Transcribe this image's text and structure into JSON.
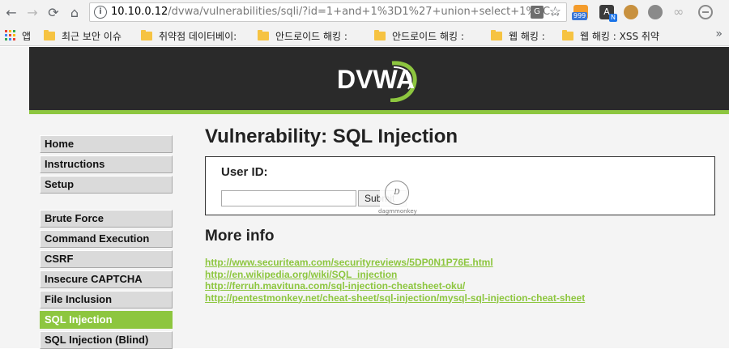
{
  "browser": {
    "back_glyph": "←",
    "forward_glyph": "→",
    "reload_glyph": "⟳",
    "home_glyph": "⌂",
    "url_host": "10.10.0.12",
    "url_rest": "/dvwa/vulnerabilities/sqli/?id=1+and+1%3D1%27+union+select+1%2C...",
    "info_glyph": "i",
    "translate_glyph": "G",
    "star_glyph": "☆",
    "rss_badge": "999",
    "translator_letter": "A",
    "translator_badge": "N",
    "link_glyph": "∞"
  },
  "bookmarks": {
    "apps_label": "앱",
    "items": [
      {
        "label": "최근 보안 이슈"
      },
      {
        "label": "취약점 데이터베이:"
      },
      {
        "label": "안드로이드 해킹 : "
      },
      {
        "label": "안드로이드 해킹 : "
      },
      {
        "label": "웹 해킹 :"
      },
      {
        "label": "웹 해킹 : XSS 취약"
      }
    ],
    "more_glyph": "»",
    "apps_colors": [
      "#ea4335",
      "#fbbc05",
      "#34a853",
      "#4285f4",
      "#ea4335",
      "#fbbc05",
      "#34a853",
      "#4285f4",
      "#ea4335"
    ]
  },
  "dvwa": {
    "logo": "DVWA",
    "accent_color": "#8dc63f",
    "menu": {
      "group1": [
        {
          "label": "Home"
        },
        {
          "label": "Instructions"
        },
        {
          "label": "Setup"
        }
      ],
      "group2": [
        {
          "label": "Brute Force"
        },
        {
          "label": "Command Execution"
        },
        {
          "label": "CSRF"
        },
        {
          "label": "Insecure CAPTCHA"
        },
        {
          "label": "File Inclusion"
        },
        {
          "label": "SQL Injection",
          "active": true
        },
        {
          "label": "SQL Injection (Blind)"
        }
      ]
    },
    "page_title": "Vulnerability: SQL Injection",
    "form": {
      "user_id_label": "User ID:",
      "user_id_value": "",
      "submit_label": "Submit"
    },
    "watermark": {
      "mark": "D",
      "caption": "dagmmonkey"
    },
    "more_info_title": "More info",
    "links": [
      "http://www.securiteam.com/securityreviews/5DP0N1P76E.html",
      "http://en.wikipedia.org/wiki/SQL_injection",
      "http://ferruh.mavituna.com/sql-injection-cheatsheet-oku/",
      "http://pentestmonkey.net/cheat-sheet/sql-injection/mysql-sql-injection-cheat-sheet"
    ]
  }
}
